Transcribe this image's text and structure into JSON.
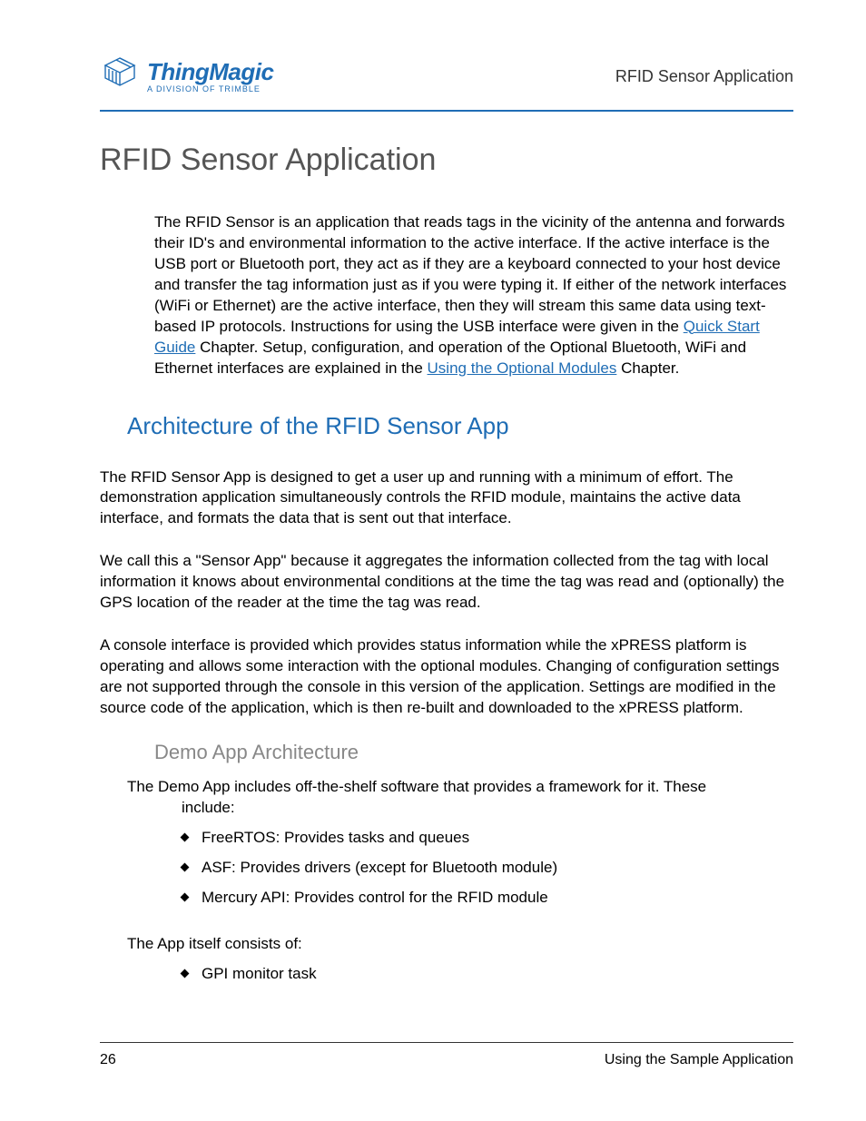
{
  "header": {
    "logo_title": "ThingMagic",
    "logo_sub": "A DIVISION OF TRIMBLE",
    "section": "RFID Sensor Application"
  },
  "title": "RFID Sensor Application",
  "intro": {
    "p1a": "The RFID Sensor is an application that reads tags in the vicinity of the antenna and forwards their ID's and environmental information to the active interface. If the active interface is the USB port or Bluetooth port, they act as if they are a keyboard connected to your host device and transfer the tag information just as if you were typing it. If either of the network interfaces (WiFi or Ethernet) are the active interface, then they will stream this same data using text-based IP protocols. Instructions for using the USB interface were given in the ",
    "link1": "Quick Start Guide",
    "p1b": " Chapter. Setup, configuration, and operation of the Optional Bluetooth, WiFi and Ethernet interfaces are explained in the ",
    "link2": "Using the Optional Modules",
    "p1c": " Chapter."
  },
  "arch": {
    "heading": "Architecture of the RFID Sensor App",
    "p1": "The RFID Sensor App is designed to get a user up and running with a minimum of effort. The demonstration application simultaneously controls the RFID module, maintains the active data interface, and formats the data that is sent out that interface.",
    "p2": "We call this a \"Sensor App\" because it aggregates the information collected from the tag with local information it knows about environmental conditions at the time the tag was read and (optionally) the GPS location of the reader at the time the tag was read.",
    "p3": "A console interface is provided which provides status information while the xPRESS platform is operating and allows some interaction with the optional modules. Changing of configuration settings are not supported through the console in this version of the application. Settings are modified in the source code of the application, which is then re-built and downloaded to the xPRESS platform."
  },
  "demo": {
    "heading": "Demo App Architecture",
    "intro_a": "The Demo App includes off-the-shelf software that provides a framework for it. These",
    "intro_b": "include:",
    "framework": [
      "FreeRTOS: Provides tasks and queues",
      "ASF: Provides drivers (except for Bluetooth module)",
      "Mercury API: Provides control for the RFID module"
    ],
    "consists_label": "The App itself consists of:",
    "consists": [
      "GPI monitor task"
    ]
  },
  "footer": {
    "page": "26",
    "label": "Using the Sample Application"
  }
}
